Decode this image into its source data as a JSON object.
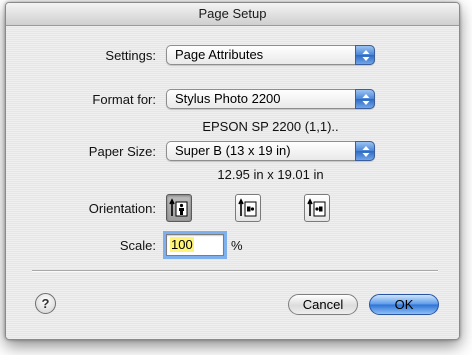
{
  "dialog": {
    "title": "Page Setup"
  },
  "settings": {
    "label": "Settings:",
    "value": "Page Attributes"
  },
  "format_for": {
    "label": "Format for:",
    "value": "Stylus Photo 2200",
    "printer_info": "EPSON SP 2200 (1,1).."
  },
  "paper_size": {
    "label": "Paper Size:",
    "value": "Super B (13 x 19 in)",
    "dimensions": "12.95 in x 19.01 in"
  },
  "orientation": {
    "label": "Orientation:",
    "options": [
      "portrait",
      "landscape-left",
      "landscape-right"
    ],
    "selected": "portrait"
  },
  "scale": {
    "label": "Scale:",
    "value": "100",
    "unit": "%"
  },
  "buttons": {
    "help": "?",
    "cancel": "Cancel",
    "ok": "OK"
  },
  "colors": {
    "default_button": "#2f73d6",
    "focus_ring": "#7fb0ee",
    "selected_text_highlight": "#fff37a"
  }
}
